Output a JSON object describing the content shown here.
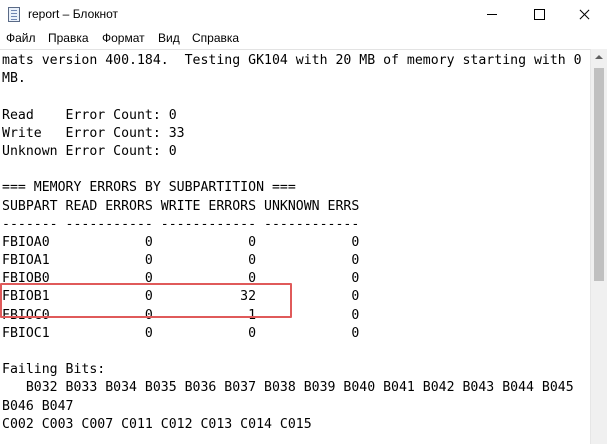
{
  "window": {
    "title": "report – Блокнот"
  },
  "menu": {
    "items": [
      "Файл",
      "Правка",
      "Формат",
      "Вид",
      "Справка"
    ]
  },
  "document": {
    "lines": [
      "mats version 400.184.  Testing GK104 with 20 MB of memory starting with 0",
      "MB.",
      "",
      "Read    Error Count: 0",
      "Write   Error Count: 33",
      "Unknown Error Count: 0",
      "",
      "=== MEMORY ERRORS BY SUBPARTITION ===",
      "SUBPART READ ERRORS WRITE ERRORS UNKNOWN ERRS",
      "------- ----------- ------------ ------------",
      "FBIOA0            0            0            0",
      "FBIOA1            0            0            0",
      "FBIOB0            0            0            0",
      "FBIOB1            0           32            0",
      "FBIOC0            0            1            0",
      "FBIOC1            0            0            0",
      "",
      "Failing Bits:",
      "   B032 B033 B034 B035 B036 B037 B038 B039 B040 B041 B042 B043 B044 B045",
      "B046 B047",
      "C002 C003 C007 C011 C012 C013 C014 C015"
    ]
  },
  "annotation": {
    "color": "#e05a5a"
  }
}
